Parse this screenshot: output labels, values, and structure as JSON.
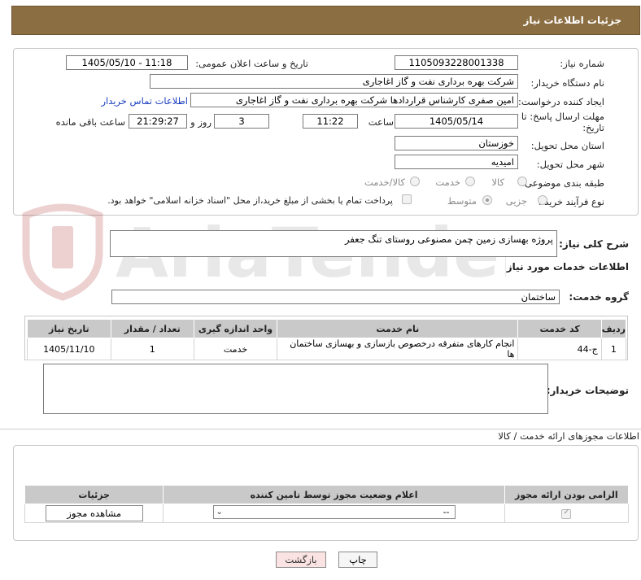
{
  "header": {
    "title": "جزئیات اطلاعات نیاز"
  },
  "need_number": {
    "label": "شماره نیاز:",
    "value": "1105093228001338"
  },
  "announce_datetime": {
    "label": "تاریخ و ساعت اعلان عمومی:",
    "value": "1405/05/10 - 11:18"
  },
  "buyer_org": {
    "label": "نام دستگاه خریدار:",
    "value": "شرکت بهره برداری نفت و گاز اغاجاری"
  },
  "requester": {
    "label": "ایجاد کننده درخواست:",
    "value": "امین صفری کارشناس قراردادها شرکت بهره برداری نفت و گاز اغاجاری",
    "contact_link": "اطلاعات تماس خریدار"
  },
  "deadline": {
    "label": "مهلت ارسال پاسخ: تا تاریخ:",
    "date": "1405/05/14",
    "time_label": "ساعت",
    "time": "11:22",
    "days": "3",
    "days_label": "روز و",
    "remaining": "21:29:27",
    "remaining_label": "ساعت باقی مانده"
  },
  "province": {
    "label": "استان محل تحویل:",
    "value": "خوزستان"
  },
  "city": {
    "label": "شهر محل تحویل:",
    "value": "امیدیه"
  },
  "category": {
    "label": "طبقه بندی موضوعی:",
    "options": [
      "کالا",
      "خدمت",
      "کالا/خدمت"
    ]
  },
  "process_type": {
    "label": "نوع فرآیند خرید :",
    "options": [
      "جزیی",
      "متوسط"
    ],
    "payment_note": "پرداخت تمام یا بخشی از مبلغ خرید،از محل \"اسناد خزانه اسلامی\" خواهد بود."
  },
  "description": {
    "label": "شرح کلی نیاز:",
    "value": "پروژه بهسازی زمین چمن مصنوعی روستای تنگ جعفر"
  },
  "services_section": {
    "title": "اطلاعات خدمات مورد نیاز"
  },
  "service_group": {
    "label": "گروه خدمت:",
    "value": "ساختمان"
  },
  "services_table": {
    "headers": [
      "ردیف",
      "کد خدمت",
      "نام خدمت",
      "واحد اندازه گیری",
      "تعداد / مقدار",
      "تاریخ نیاز"
    ],
    "rows": [
      [
        "1",
        "ج-44",
        "انجام کارهای متفرقه درخصوص بازسازی و بهسازی ساختمان ها",
        "خدمت",
        "1",
        "1405/11/10"
      ]
    ]
  },
  "buyer_notes": {
    "label": "توضیحات خریدار:",
    "value": ""
  },
  "permits": {
    "title": "اطلاعات مجوزهای ارائه خدمت / کالا",
    "headers": [
      "الزامی بودن ارائه مجوز",
      "اعلام وضعیت مجوز توسط تامین کننده",
      "جزئیات"
    ],
    "select_value": "--",
    "view_button": "مشاهده مجوز"
  },
  "actions": {
    "print": "چاپ",
    "back": "بازگشت"
  },
  "watermark": {
    "text": "AriaTender.neT"
  },
  "colors": {
    "header_bg": "#8c6e43",
    "table_header_bg": "#c9c9c9",
    "link": "#1a3fbf",
    "back_button_bg": "#fbe3e3"
  }
}
